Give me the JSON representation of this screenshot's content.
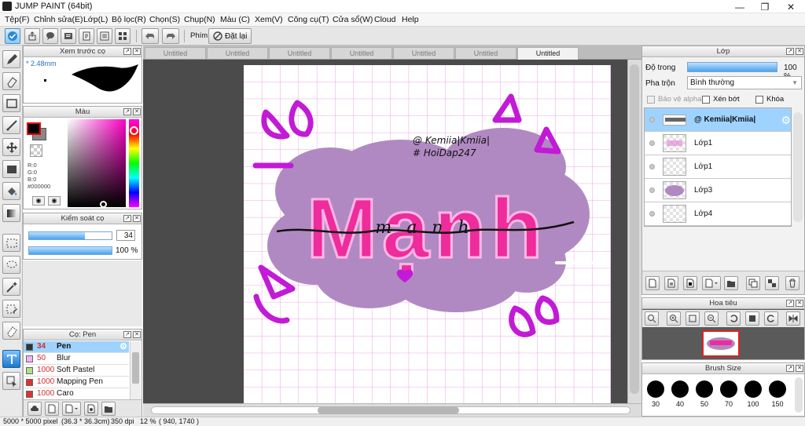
{
  "window": {
    "title": "JUMP PAINT (64bit)",
    "controls": [
      "minimize-icon",
      "restore-icon",
      "close-icon"
    ]
  },
  "menu": [
    "Tệp(F)",
    "Chỉnh sửa(E)",
    "Lớp(L)",
    "Bộ lọc(R)",
    "Chọn(S)",
    "Chụp(N)",
    "Màu (C)",
    "Xem(V)",
    "Công cụ(T)",
    "Cửa sổ(W)",
    "Cloud",
    "Help"
  ],
  "toolbar": {
    "snap_label": "Phím",
    "reset_label": "Đặt lại"
  },
  "tabs": [
    "Untitled",
    "Untitled",
    "Untitled",
    "Untitled",
    "Untitled",
    "Untitled",
    "Untitled"
  ],
  "active_tab_index": 6,
  "brush_preview": {
    "title": "Xem trước cọ",
    "size": "* 2.48mm"
  },
  "color_panel": {
    "title": "Màu",
    "r": "R:0",
    "g": "G:0",
    "b": "B:0",
    "hex": "#000000",
    "main_color": "#000000"
  },
  "brush_control": {
    "title": "Kiểm soát cọ",
    "size_value": "34",
    "opacity_value": "100 %",
    "size_fraction": 0.68,
    "opacity_fraction": 1.0
  },
  "brush_list": {
    "title": "Cọ: Pen",
    "items": [
      {
        "size": "34",
        "name": "Pen",
        "color": "#333333",
        "selected": true
      },
      {
        "size": "50",
        "name": "Blur",
        "color": "#f3b3f3",
        "selected": false
      },
      {
        "size": "1000",
        "name": "Soft Pastel",
        "color": "#b3e080",
        "selected": false
      },
      {
        "size": "1000",
        "name": "Mapping Pen",
        "color": "#e03030",
        "selected": false
      },
      {
        "size": "1000",
        "name": "Caro",
        "color": "#e03030",
        "selected": false
      }
    ]
  },
  "canvas": {
    "line1": "@ Kemiia|Kmiia|",
    "line2": "# HoiDap247",
    "main_word": "Mạnh",
    "script_word": "m  a  n  h"
  },
  "layers": {
    "title": "Lớp",
    "opacity_label": "Độ trong",
    "opacity_value": "100 %",
    "opacity_fraction": 1.0,
    "blend_label": "Pha trộn",
    "blend_value": "Bình thường",
    "protect_alpha": "Bảo vệ alpha",
    "clipping": "Xén bớt",
    "lock": "Khóa",
    "rows": [
      {
        "name": "@ Kemiia|Kmiia|",
        "selected": true
      },
      {
        "name": "Lớp1",
        "selected": false
      },
      {
        "name": "Lớp1",
        "selected": false
      },
      {
        "name": "Lớp3",
        "selected": false
      },
      {
        "name": "Lớp4",
        "selected": false
      }
    ]
  },
  "navigator": {
    "title": "Hoa tiêu"
  },
  "brush_size": {
    "title": "Brush Size",
    "sizes": [
      "30",
      "40",
      "50",
      "70",
      "100",
      "150"
    ]
  },
  "status": {
    "dimensions": "5000 * 5000 pixel",
    "size_cm": "(36.3 * 36.3cm)",
    "dpi": "350 dpi",
    "zoom": "12 %",
    "coords": "( 940, 1740 )"
  },
  "colors": {
    "accent": "#3c9be6",
    "selected_row": "#9fd3ff",
    "magenta": "#c21ad6",
    "pink": "#ee2c9c",
    "purple_blob": "#b189c2"
  }
}
